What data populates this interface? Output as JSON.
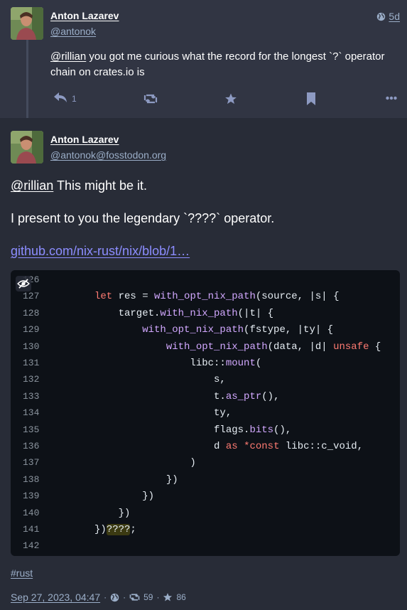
{
  "reply": {
    "author_name": "Anton Lazarev",
    "author_handle": "@antonok",
    "time": "5d",
    "mention": "@rillian",
    "text": " you got me curious what the record for the longest `?` operator chain on crates.io is",
    "reply_count": "1"
  },
  "status": {
    "author_name": "Anton Lazarev",
    "author_handle": "@antonok@fosstodon.org",
    "mention": "@rillian",
    "line1_rest": " This might be it.",
    "line2": "I present to you the legendary `????` operator.",
    "link": "github.com/nix-rust/nix/blob/1…",
    "hashtag": "#rust",
    "date": "Sep 27, 2023, 04:47",
    "reblogs": "59",
    "favourites": "86"
  },
  "code": {
    "lines": [
      {
        "n": "126",
        "segs": []
      },
      {
        "n": "127",
        "segs": [
          {
            "t": "",
            "c": ""
          },
          {
            "t": "let",
            "c": "kw"
          },
          {
            "t": " res = ",
            "c": ""
          },
          {
            "t": "with_opt_nix_path",
            "c": "fn"
          },
          {
            "t": "(source, |s| {",
            "c": ""
          }
        ]
      },
      {
        "n": "128",
        "segs": [
          {
            "t": "    target.",
            "c": ""
          },
          {
            "t": "with_nix_path",
            "c": "fn"
          },
          {
            "t": "(|t| {",
            "c": ""
          }
        ]
      },
      {
        "n": "129",
        "segs": [
          {
            "t": "        ",
            "c": ""
          },
          {
            "t": "with_opt_nix_path",
            "c": "fn"
          },
          {
            "t": "(fstype, |ty| {",
            "c": ""
          }
        ]
      },
      {
        "n": "130",
        "segs": [
          {
            "t": "            ",
            "c": ""
          },
          {
            "t": "with_opt_nix_path",
            "c": "fn"
          },
          {
            "t": "(data, |d| ",
            "c": ""
          },
          {
            "t": "unsafe",
            "c": "kw"
          },
          {
            "t": " {",
            "c": ""
          }
        ]
      },
      {
        "n": "131",
        "segs": [
          {
            "t": "                libc::",
            "c": ""
          },
          {
            "t": "mount",
            "c": "fn"
          },
          {
            "t": "(",
            "c": ""
          }
        ]
      },
      {
        "n": "132",
        "segs": [
          {
            "t": "                    s,",
            "c": ""
          }
        ]
      },
      {
        "n": "133",
        "segs": [
          {
            "t": "                    t.",
            "c": ""
          },
          {
            "t": "as_ptr",
            "c": "fn"
          },
          {
            "t": "(),",
            "c": ""
          }
        ]
      },
      {
        "n": "134",
        "segs": [
          {
            "t": "                    ty,",
            "c": ""
          }
        ]
      },
      {
        "n": "135",
        "segs": [
          {
            "t": "                    flags.",
            "c": ""
          },
          {
            "t": "bits",
            "c": "fn"
          },
          {
            "t": "(),",
            "c": ""
          }
        ]
      },
      {
        "n": "136",
        "segs": [
          {
            "t": "                    d ",
            "c": ""
          },
          {
            "t": "as",
            "c": "kw"
          },
          {
            "t": " ",
            "c": ""
          },
          {
            "t": "*const",
            "c": "kw"
          },
          {
            "t": " libc::c_void,",
            "c": ""
          }
        ]
      },
      {
        "n": "137",
        "segs": [
          {
            "t": "                )",
            "c": ""
          }
        ]
      },
      {
        "n": "138",
        "segs": [
          {
            "t": "            })",
            "c": ""
          }
        ]
      },
      {
        "n": "139",
        "segs": [
          {
            "t": "        })",
            "c": ""
          }
        ]
      },
      {
        "n": "140",
        "segs": [
          {
            "t": "    })",
            "c": ""
          }
        ]
      },
      {
        "n": "141",
        "segs": [
          {
            "t": "})",
            "c": ""
          },
          {
            "t": "????",
            "c": "hl"
          },
          {
            "t": ";",
            "c": ""
          }
        ]
      },
      {
        "n": "142",
        "segs": []
      }
    ]
  },
  "icons": {
    "reply": "reply-all-icon",
    "boost": "retweet-icon",
    "favourite": "star-icon",
    "bookmark": "bookmark-icon",
    "more": "ellipsis-icon",
    "visibility": "globe-icon",
    "hide_media": "eye-slash-icon"
  },
  "colors": {
    "background": "#282c37",
    "reply_background": "#313543",
    "link": "#8c8dff",
    "muted": "#9baec8",
    "code_background": "#0d1117"
  }
}
